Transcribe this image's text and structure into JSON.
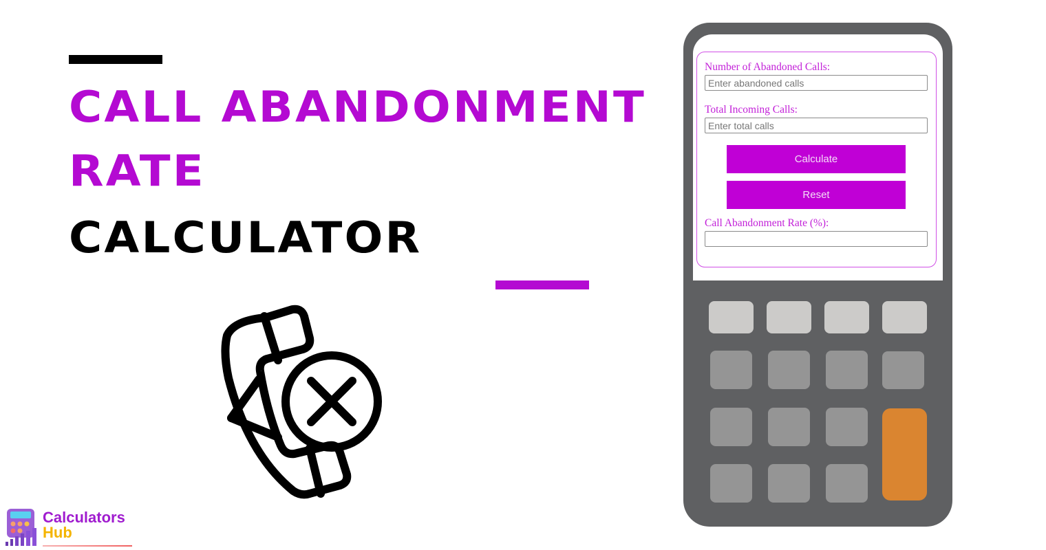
{
  "header": {
    "title_line_1": "Call Abandonment",
    "title_line_2": "Rate",
    "title_line_3": "Calculator"
  },
  "colors": {
    "accent": "#b40ad2",
    "button": "#c000d6",
    "calculator_body": "#5f6062",
    "key_light": "#cccbc9",
    "key_mid": "#959595",
    "key_orange": "#da8530"
  },
  "illustration": {
    "icon": "phone-cancel-icon"
  },
  "form": {
    "abandoned_label": "Number of Abandoned Calls:",
    "abandoned_placeholder": "Enter abandoned calls",
    "abandoned_value": "",
    "total_label": "Total Incoming Calls:",
    "total_placeholder": "Enter total calls",
    "total_value": "",
    "calculate_label": "Calculate",
    "reset_label": "Reset",
    "result_label": "Call Abandonment Rate (%):",
    "result_value": ""
  },
  "logo": {
    "line_1": "Calculators",
    "line_2": "Hub"
  }
}
